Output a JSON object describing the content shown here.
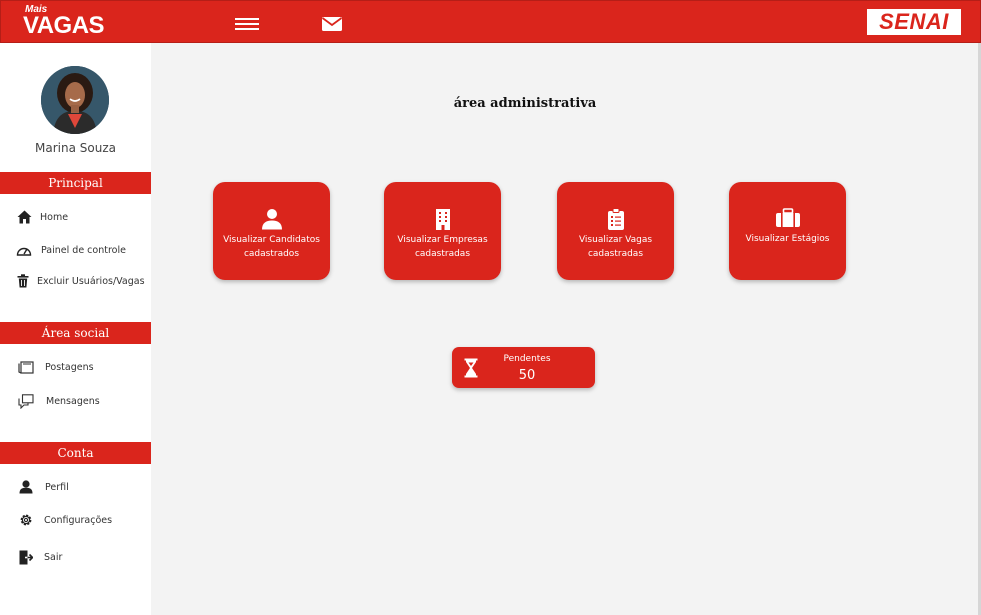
{
  "header": {
    "logo_small": "Mais",
    "logo_big": "VAGAS",
    "menu_icon": "hamburger-menu-icon",
    "mail_icon": "envelope-icon",
    "brand": "SENAI",
    "accent_color": "#da251c"
  },
  "profile": {
    "name": "Marina Souza"
  },
  "sidebar": {
    "sections": [
      {
        "title": "Principal",
        "items": [
          {
            "label": "Home",
            "icon": "home-icon"
          },
          {
            "label": "Painel de controle",
            "icon": "gauge-icon"
          },
          {
            "label": "Excluir Usuários/Vagas",
            "icon": "trash-icon"
          }
        ]
      },
      {
        "title": "Área social",
        "items": [
          {
            "label": "Postagens",
            "icon": "posts-icon"
          },
          {
            "label": "Mensagens",
            "icon": "chat-icon"
          }
        ]
      },
      {
        "title": "Conta",
        "items": [
          {
            "label": "Perfil",
            "icon": "user-icon"
          },
          {
            "label": "Configurações",
            "icon": "gear-icon"
          },
          {
            "label": "Sair",
            "icon": "logout-icon"
          }
        ]
      }
    ]
  },
  "main": {
    "title": "área administrativa",
    "cards": [
      {
        "label": "Visualizar Candidatos cadastrados",
        "icon": "user-icon"
      },
      {
        "label": "Visualizar Empresas cadastradas",
        "icon": "building-icon"
      },
      {
        "label": "Visualizar Vagas cadastradas",
        "icon": "clipboard-icon"
      },
      {
        "label": "Visualizar Estágios",
        "icon": "briefcase-icon"
      }
    ],
    "pending": {
      "label": "Pendentes",
      "value": "50",
      "icon": "hourglass-icon"
    }
  }
}
